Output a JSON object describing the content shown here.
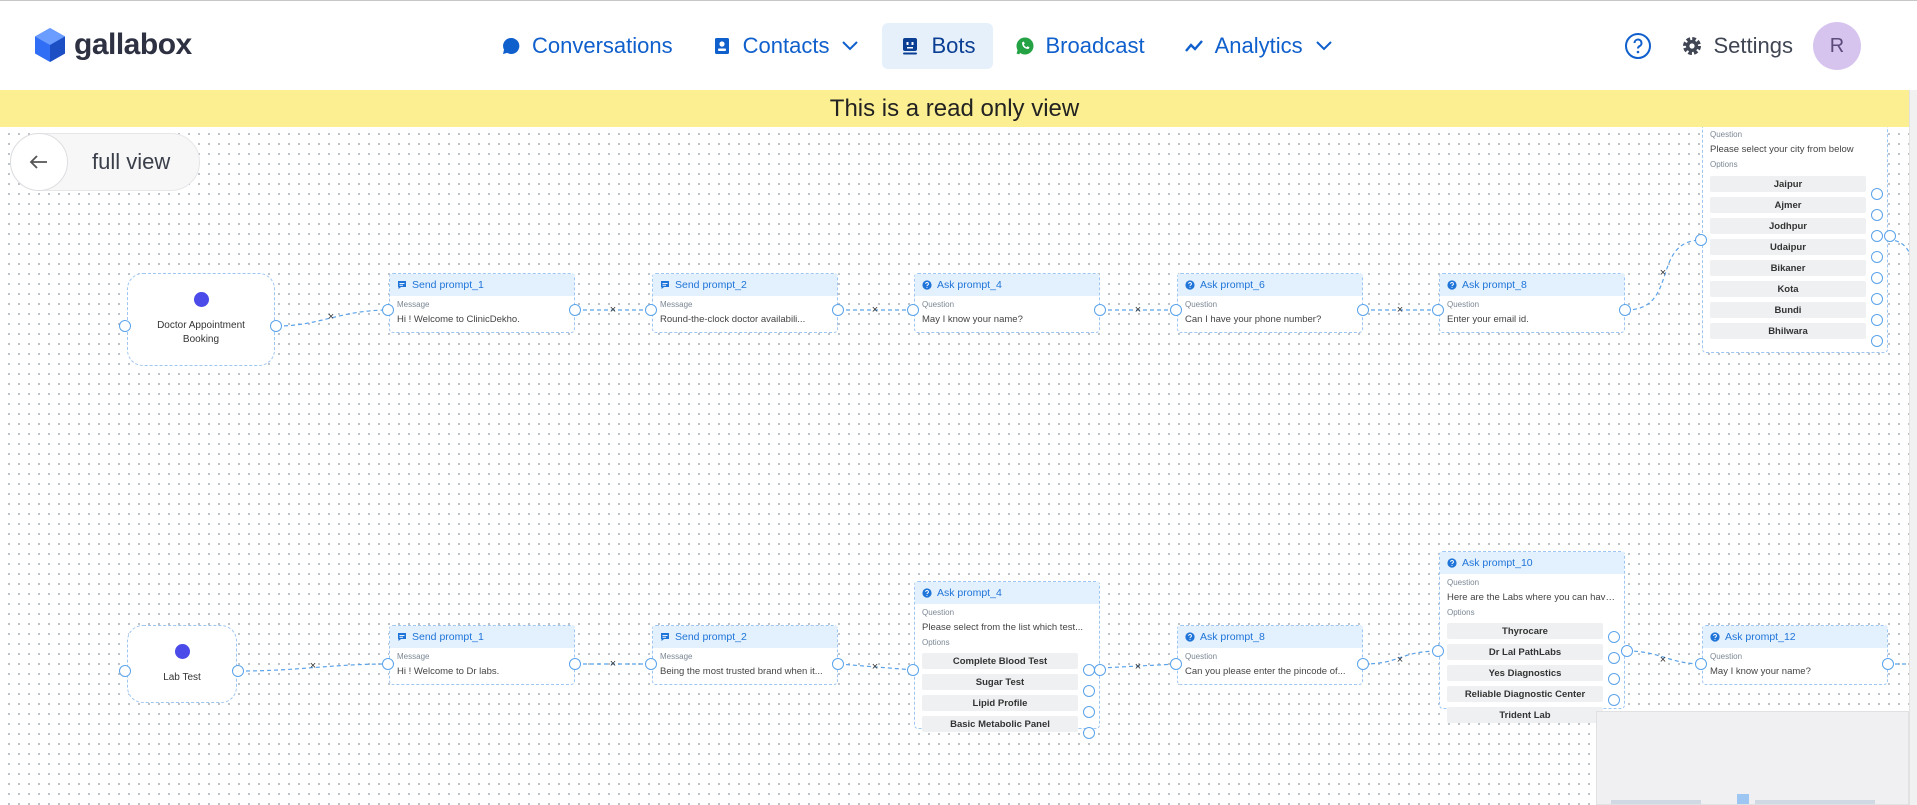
{
  "brand": {
    "name": "gallabox",
    "logo_icon": "cube-logo-icon",
    "color": "#2f6ef5"
  },
  "nav": {
    "items": [
      {
        "label": "Conversations",
        "icon": "chat-bubble-icon",
        "dropdown": false,
        "active": false
      },
      {
        "label": "Contacts",
        "icon": "contact-book-icon",
        "dropdown": true,
        "active": false
      },
      {
        "label": "Bots",
        "icon": "bot-icon",
        "dropdown": false,
        "active": true
      },
      {
        "label": "Broadcast",
        "icon": "whatsapp-icon",
        "dropdown": false,
        "active": false
      },
      {
        "label": "Analytics",
        "icon": "trend-line-icon",
        "dropdown": true,
        "active": false
      }
    ]
  },
  "header": {
    "help_icon": "help-circle-icon",
    "settings_label": "Settings",
    "settings_icon": "gear-icon",
    "avatar_initial": "R"
  },
  "banner": {
    "text": "This is a read only view",
    "color": "#fbef92"
  },
  "canvas": {
    "back_icon": "arrow-left-icon",
    "view_label": "full view"
  },
  "flows": [
    {
      "start": {
        "label": "Doctor Appointment Booking"
      },
      "nodes": [
        {
          "title": "Send prompt_1",
          "kind": "send",
          "sub": "Message",
          "text": "Hi ! Welcome to ClinicDekho."
        },
        {
          "title": "Send prompt_2",
          "kind": "send",
          "sub": "Message",
          "text": "Round-the-clock doctor availabili..."
        },
        {
          "title": "Ask prompt_4",
          "kind": "ask",
          "sub": "Question",
          "text": "May I know your name?"
        },
        {
          "title": "Ask prompt_6",
          "kind": "ask",
          "sub": "Question",
          "text": "Can I have your phone number?"
        },
        {
          "title": "Ask prompt_8",
          "kind": "ask",
          "sub": "Question",
          "text": "Enter your email id."
        },
        {
          "title": "",
          "kind": "ask",
          "sub": "Question",
          "text": "Please select your city from below",
          "options_label": "Options",
          "options": [
            "Jaipur",
            "Ajmer",
            "Jodhpur",
            "Udaipur",
            "Bikaner",
            "Kota",
            "Bundi",
            "Bhilwara"
          ]
        }
      ]
    },
    {
      "start": {
        "label": "Lab Test"
      },
      "nodes": [
        {
          "title": "Send prompt_1",
          "kind": "send",
          "sub": "Message",
          "text": "Hi ! Welcome to Dr labs."
        },
        {
          "title": "Send prompt_2",
          "kind": "send",
          "sub": "Message",
          "text": "Being the most trusted brand when it..."
        },
        {
          "title": "Ask prompt_4",
          "kind": "ask",
          "sub": "Question",
          "text": "Please select from the list which test...",
          "options_label": "Options",
          "options": [
            "Complete Blood Test",
            "Sugar Test",
            "Lipid Profile",
            "Basic Metabolic Panel"
          ]
        },
        {
          "title": "Ask prompt_8",
          "kind": "ask",
          "sub": "Question",
          "text": "Can you please enter the pincode of..."
        },
        {
          "title": "Ask prompt_10",
          "kind": "ask",
          "sub": "Question",
          "text": "Here are the Labs where you can have...",
          "options_label": "Options",
          "options": [
            "Thyrocare",
            "Dr Lal PathLabs",
            "Yes Diagnostics",
            "Reliable Diagnostic Center",
            "Trident Lab"
          ]
        },
        {
          "title": "Ask prompt_12",
          "kind": "ask",
          "sub": "Question",
          "text": "May I know your name?"
        }
      ]
    }
  ],
  "edge_delete_glyph": "×"
}
